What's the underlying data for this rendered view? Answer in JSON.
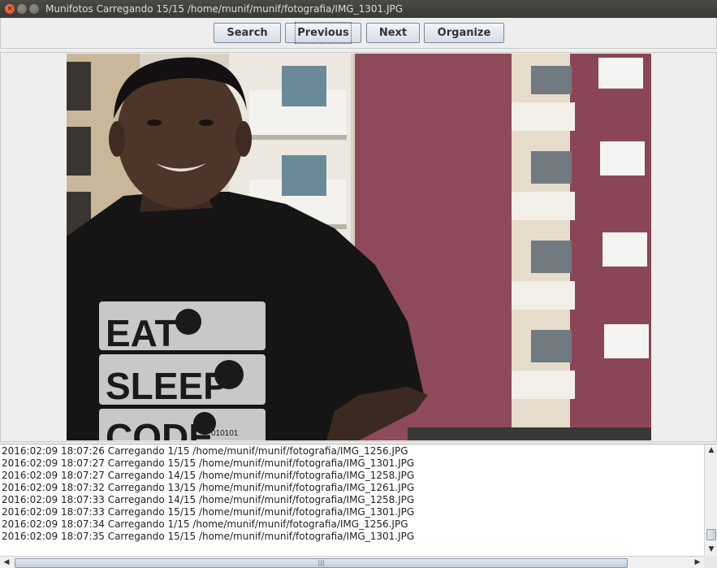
{
  "window": {
    "title": "Munifotos Carregando 15/15 /home/munif/munif/fotografia/IMG_1301.JPG",
    "close_glyph": "×",
    "min_glyph": "–",
    "max_glyph": "□"
  },
  "toolbar": {
    "search_label": "Search",
    "previous_label": "Previous",
    "next_label": "Next",
    "organize_label": "Organize"
  },
  "photo": {
    "shirt_lines": [
      "EAT",
      "SLEEP",
      "CODE"
    ],
    "binary_text": "010101"
  },
  "log": {
    "lines": [
      "2016:02:09 18:07:26 Carregando 1/15 /home/munif/munif/fotografia/IMG_1256.JPG",
      "2016:02:09 18:07:27 Carregando 15/15 /home/munif/munif/fotografia/IMG_1301.JPG",
      "2016:02:09 18:07:27 Carregando 14/15 /home/munif/munif/fotografia/IMG_1258.JPG",
      "2016:02:09 18:07:32 Carregando 13/15 /home/munif/munif/fotografia/IMG_1261.JPG",
      "2016:02:09 18:07:33 Carregando 14/15 /home/munif/munif/fotografia/IMG_1258.JPG",
      "2016:02:09 18:07:33 Carregando 15/15 /home/munif/munif/fotografia/IMG_1301.JPG",
      "2016:02:09 18:07:34 Carregando 1/15 /home/munif/munif/fotografia/IMG_1256.JPG",
      "2016:02:09 18:07:35 Carregando 15/15 /home/munif/munif/fotografia/IMG_1301.JPG"
    ]
  },
  "scroll": {
    "up_glyph": "▲",
    "down_glyph": "▼",
    "left_glyph": "◀",
    "right_glyph": "▶",
    "grip_glyph": "|||"
  }
}
